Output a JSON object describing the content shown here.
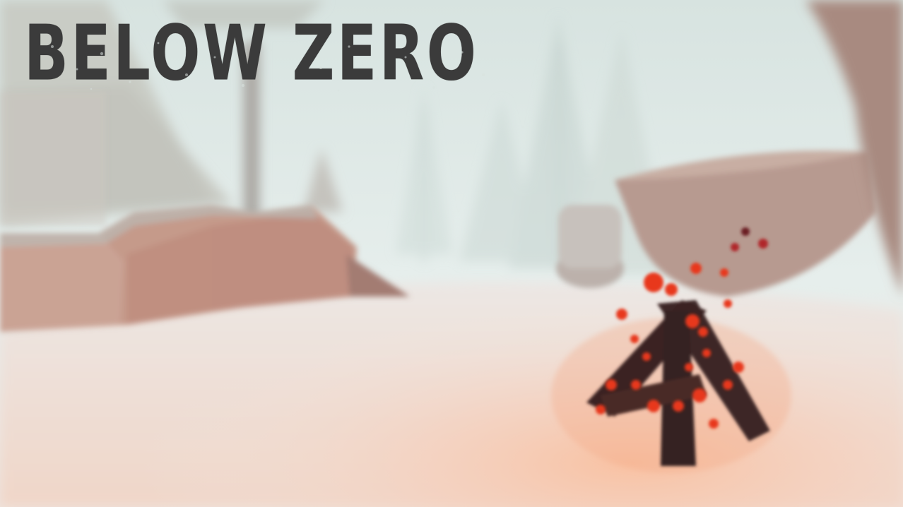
{
  "game": {
    "title": "BELOW ZERO"
  },
  "colors": {
    "fog": "#dfe9e6",
    "snow": "#f1e3dc",
    "fire_glow": "#f8c6a8",
    "rock": "#b79a90",
    "log": "#3a2524",
    "ember": "#e8391f",
    "title": "#3b3b3b"
  },
  "scene_objects": {
    "left_cliff": "rock-wall",
    "right_cliff": "rock-wall",
    "trees": "pine-tree",
    "campfire": "campfire-icon"
  }
}
